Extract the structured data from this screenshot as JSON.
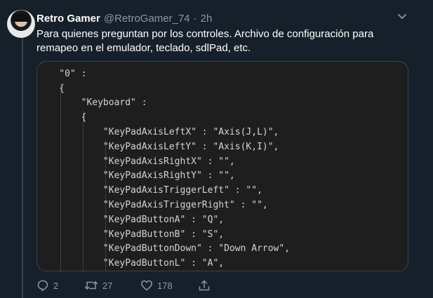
{
  "tweet": {
    "display_name": "Retro Gamer",
    "handle": "@RetroGamer_74",
    "separator": "·",
    "time": "2h",
    "text": "Para quienes preguntan por los controles. Archivo de configuración para remapeo en el emulador, teclado, sdlPad, etc."
  },
  "code_image": {
    "lines": [
      "{",
      "    \"0\" :",
      "    {",
      "        \"Keyboard\" :",
      "        {",
      "            \"KeyPadAxisLeftX\" : \"Axis(J,L)\",",
      "            \"KeyPadAxisLeftY\" : \"Axis(K,I)\",",
      "            \"KeyPadAxisRightX\" : \"\",",
      "            \"KeyPadAxisRightY\" : \"\",",
      "            \"KeyPadAxisTriggerLeft\" : \"\",",
      "            \"KeyPadAxisTriggerRight\" : \"\",",
      "            \"KeyPadButtonA\" : \"Q\",",
      "            \"KeyPadButtonB\" : \"S\",",
      "            \"KeyPadButtonDown\" : \"Down Arrow\",",
      "            \"KeyPadButtonL\" : \"A\","
    ]
  },
  "actions": {
    "reply_count": "2",
    "retweet_count": "27",
    "like_count": "178"
  },
  "colors": {
    "background": "#15202b",
    "muted": "#8899a6",
    "code_bg": "#1e1e1e",
    "code_text": "#d4d4d4"
  },
  "icons": {
    "menu": "chevron-down-icon",
    "reply": "reply-icon",
    "retweet": "retweet-icon",
    "like": "heart-icon",
    "share": "share-icon"
  }
}
